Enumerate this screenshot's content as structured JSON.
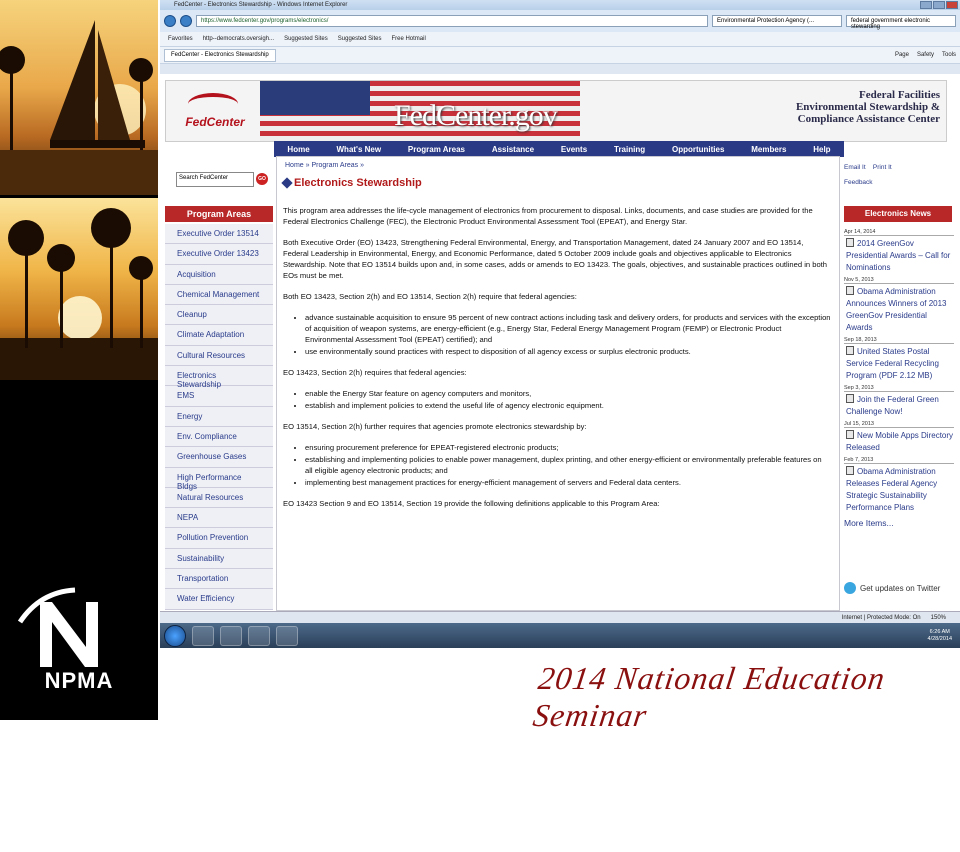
{
  "browser": {
    "window_title": "FedCenter - Electronics Stewardship - Windows Internet Explorer",
    "url": "https://www.fedcenter.gov/programs/electronics/",
    "security_identity": "Environmental Protection Agency (...",
    "search_box": "federal government electronic stewarding",
    "favorites": [
      "Favorites",
      "http--democrats.oversigh...",
      "Suggested Sites",
      "Suggested Sites",
      "Free Hotmail"
    ],
    "tab_title": "FedCenter - Electronics Stewardship",
    "tools": [
      "Page",
      "Safety",
      "Tools"
    ],
    "status_zone": "Internet | Protected Mode: On",
    "zoom": "150%",
    "clock_time": "6:26 AM",
    "clock_date": "4/28/2014"
  },
  "site": {
    "logo_text": "FedCenter",
    "name": "FedCenter.gov",
    "title_lines": [
      "Federal Facilities",
      "Environmental Stewardship &",
      "Compliance Assistance Center"
    ],
    "nav": [
      "Home",
      "What's New",
      "Program Areas",
      "Assistance",
      "Events",
      "Training",
      "Opportunities",
      "Members",
      "Help"
    ],
    "search_placeholder": "Search FedCenter",
    "go": "GO"
  },
  "sidebar": {
    "heading": "Program Areas",
    "items": [
      "Executive Order 13514",
      "Executive Order 13423",
      "Acquisition",
      "Chemical Management",
      "Cleanup",
      "Climate Adaptation",
      "Cultural Resources",
      "Electronics Stewardship",
      "EMS",
      "Energy",
      "Env. Compliance",
      "Greenhouse Gases",
      "High Performance Bldgs",
      "Natural Resources",
      "NEPA",
      "Pollution Prevention",
      "Sustainability",
      "Transportation",
      "Water Efficiency"
    ]
  },
  "main": {
    "breadcrumb": "Home » Program Areas »",
    "title": "Electronics Stewardship",
    "p1": "This program area addresses the life-cycle management of electronics from procurement to disposal. Links, documents, and case studies are provided for the Federal Electronics Challenge (FEC), the Electronic Product Environmental Assessment Tool (EPEAT), and Energy Star.",
    "p2": "Both Executive Order (EO) 13423, Strengthening Federal Environmental, Energy, and Transportation Management, dated 24 January 2007 and EO 13514, Federal Leadership in Environmental, Energy, and Economic Performance, dated 5 October 2009 include goals and objectives applicable to Electronics Stewardship. Note that EO 13514 builds upon and, in some cases, adds or amends to EO 13423. The goals, objectives, and sustainable practices outlined in both EOs must be met.",
    "p3": "Both EO 13423, Section 2(h) and EO 13514, Section 2(h) require that federal agencies:",
    "list1": [
      "advance sustainable acquisition to ensure 95 percent of new contract actions including task and delivery orders, for products and services with the exception of acquisition of weapon systems, are energy-efficient (e.g., Energy Star, Federal Energy Management Program (FEMP) or Electronic Product Environmental Assessment Tool (EPEAT) certified); and",
      "use environmentally sound practices with respect to disposition of all agency excess or surplus electronic products."
    ],
    "p4": "EO 13423, Section 2(h) requires that federal agencies:",
    "list2": [
      "enable the Energy Star feature on agency computers and monitors,",
      "establish and implement policies to extend the useful life of agency electronic equipment."
    ],
    "p5": "EO 13514, Section 2(h) further requires that agencies promote electronics stewardship by:",
    "list3": [
      "ensuring procurement preference for EPEAT-registered electronic products;",
      "establishing and implementing policies to enable power management, duplex printing, and other energy-efficient or environmentally preferable features on all eligible agency electronic products; and",
      "implementing best management practices for energy-efficient management of servers and Federal data centers."
    ],
    "p6": "EO 13423 Section 9 and EO 13514, Section 19 provide the following definitions applicable to this Program Area:"
  },
  "right": {
    "email": "Email It",
    "print": "Print It",
    "feedback": "Feedback",
    "news_heading": "Electronics News",
    "news": [
      {
        "date": "Apr 14, 2014",
        "title": "2014 GreenGov Presidential Awards – Call for Nominations"
      },
      {
        "date": "Nov 5, 2013",
        "title": "Obama Administration Announces Winners of 2013 GreenGov Presidential Awards"
      },
      {
        "date": "Sep 18, 2013",
        "title": "United States Postal Service Federal Recycling Program (PDF 2.12 MB)"
      },
      {
        "date": "Sep 3, 2013",
        "title": "Join the Federal Green Challenge Now!"
      },
      {
        "date": "Jul 15, 2013",
        "title": "New Mobile Apps Directory Released"
      },
      {
        "date": "Feb 7, 2013",
        "title": "Obama Administration Releases Federal Agency Strategic Sustainability Performance Plans"
      }
    ],
    "more": "More Items...",
    "twitter": "Get updates on Twitter"
  },
  "slide": {
    "org": "NPMA",
    "banner": "2014 National Education Seminar",
    "accent": "#8a1010"
  }
}
